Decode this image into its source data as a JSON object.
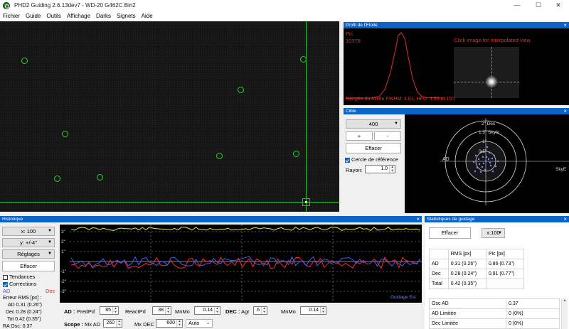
{
  "window": {
    "title": "PHD2 Guiding 2.6.13dev7 - WD-20 G462C Bin2",
    "min": "—",
    "max": "☐",
    "close": "✕"
  },
  "menu": [
    "Fichier",
    "Guide",
    "Outils",
    "Affichage",
    "Darks",
    "Signets",
    "Aide"
  ],
  "profile": {
    "header": "Profil de l'Etoile",
    "peak_label": "Pic",
    "peak_value": "10378",
    "hint": "Click image for interpolated view",
    "footer": "Rangée du Milieu FWHM: 4.01, HFD: 4.90 (4.15\")"
  },
  "target": {
    "header": "Cible",
    "scale_value": "400",
    "plus": "+",
    "minus": "-",
    "clear": "Effacer",
    "ref_circle": "Cercle de référence",
    "radius_label": "Rayon:",
    "radius_value": "1.0",
    "labels": {
      "dec": "2\" Dec",
      "skyn": "1.5\" SkyN",
      "one": "1\"",
      "half": "0.5\"",
      "ad": "AD",
      "skye": "SkyE"
    }
  },
  "history": {
    "header": "Historique",
    "x_scale": "x: 100",
    "y_scale": "y: +/-4\"",
    "settings": "Réglages",
    "clear": "Effacer",
    "trends": "Tendances",
    "corrections": "Corrections",
    "ra_label": "AD",
    "dec_label": "Dec",
    "rms_title": "Erreur RMS [px] :",
    "rms_ad": "AD  0.31 (0.26\")",
    "rms_dec": "Dec  0.28 (0.24\")",
    "rms_tot": "Tot  0.42 (0.35\")",
    "ra_osc": "RA Osc: 0.37",
    "y_ticks": [
      "3\"",
      "2\"",
      "1\"",
      "-1\"",
      "-2\"",
      "-3\""
    ],
    "graph_label": "Guidage Est",
    "colors": {
      "ra": "#3a63ff",
      "dec": "#ff2a2a",
      "snr": "#e8e84a"
    }
  },
  "controls": {
    "ad_label": "AD :",
    "predpd_label": "PredPd",
    "predpd": "85",
    "reactpd_label": "ReactPd",
    "reactpd": "38",
    "mnmo_label": "MnMo",
    "mnmo_ad": "0.14",
    "dec_label": "DEC :",
    "agr_label": "Agr",
    "agr": "6",
    "mnmo_dec": "0.14",
    "scope_label": "Scope :",
    "mxad_label": "Mx AD",
    "mxad": "260",
    "mxdec_label": "Mx DEC",
    "mxdec": "600",
    "auto": "Auto"
  },
  "stats": {
    "header": "Statistiques de guidage",
    "clear": "Effacer",
    "x_scale": "x:100",
    "columns": [
      "",
      "RMS [px]",
      "Pic [px]"
    ],
    "rows": [
      [
        "AD",
        "0.31 (0.26\")",
        "0.86 (0.73\")"
      ],
      [
        "Dec",
        "0.28 (0.24\")",
        "0.91 (0.77\")"
      ],
      [
        "Total",
        "0.42 (0.35\")",
        ""
      ]
    ],
    "extra": [
      [
        "Osc AD",
        "0.37"
      ],
      [
        "AD Limitée",
        "0 (0%)"
      ],
      [
        "Dec Limitée",
        "0 (0%)"
      ]
    ]
  }
}
